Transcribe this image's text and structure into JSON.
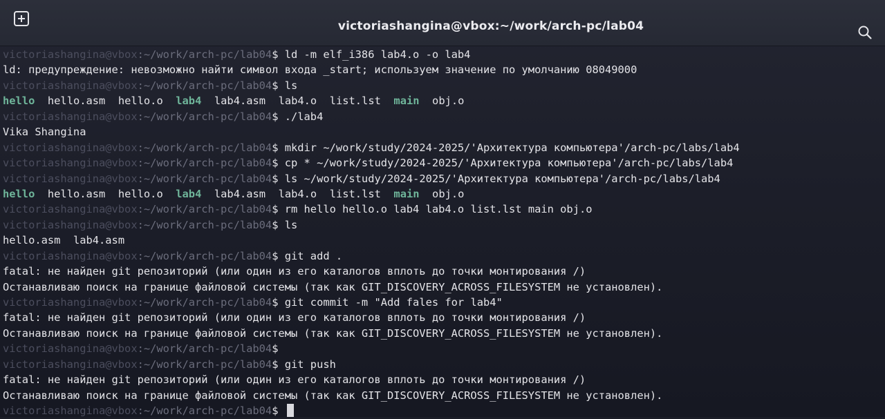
{
  "window": {
    "title": "victoriashangina@vbox:~/work/arch-pc/lab04",
    "new_tab_icon": "new-tab-icon",
    "search_icon": "search-icon"
  },
  "prompt": {
    "user": "victoriashangina@vbox",
    "path": ":~/work/arch-pc/lab04",
    "symbol": "$"
  },
  "colors": {
    "background": "#1b1d27",
    "text": "#e4e4e8",
    "prompt_user": "#4c4e5e",
    "prompt_path": "#6b6d7c",
    "executable": "#6fb59a"
  },
  "terminal": {
    "lines": [
      {
        "type": "prompt",
        "cmd": " ld -m elf_i386 lab4.o -o lab4"
      },
      {
        "type": "output",
        "text": "ld: предупреждение: невозможно найти символ входа _start; используем значение по умолчанию 08049000"
      },
      {
        "type": "prompt",
        "cmd": " ls"
      },
      {
        "type": "ls",
        "items": [
          {
            "name": "hello",
            "exe": true
          },
          {
            "name": "hello.asm",
            "exe": false
          },
          {
            "name": "hello.o",
            "exe": false
          },
          {
            "name": "lab4",
            "exe": true
          },
          {
            "name": "lab4.asm",
            "exe": false
          },
          {
            "name": "lab4.o",
            "exe": false
          },
          {
            "name": "list.lst",
            "exe": false
          },
          {
            "name": "main",
            "exe": true
          },
          {
            "name": "obj.o",
            "exe": false
          }
        ]
      },
      {
        "type": "prompt",
        "cmd": " ./lab4"
      },
      {
        "type": "output",
        "text": "Vika Shangina"
      },
      {
        "type": "prompt",
        "cmd": " mkdir ~/work/study/2024-2025/'Архитектура компьютера'/arch-pc/labs/lab4"
      },
      {
        "type": "prompt",
        "cmd": " cp * ~/work/study/2024-2025/'Архитектура компьютера'/arch-pc/labs/lab4"
      },
      {
        "type": "prompt",
        "cmd": " ls ~/work/study/2024-2025/'Архитектура компьютера'/arch-pc/labs/lab4"
      },
      {
        "type": "ls",
        "items": [
          {
            "name": "hello",
            "exe": true
          },
          {
            "name": "hello.asm",
            "exe": false
          },
          {
            "name": "hello.o",
            "exe": false
          },
          {
            "name": "lab4",
            "exe": true
          },
          {
            "name": "lab4.asm",
            "exe": false
          },
          {
            "name": "lab4.o",
            "exe": false
          },
          {
            "name": "list.lst",
            "exe": false
          },
          {
            "name": "main",
            "exe": true
          },
          {
            "name": "obj.o",
            "exe": false
          }
        ]
      },
      {
        "type": "prompt",
        "cmd": " rm hello hello.o lab4 lab4.o list.lst main obj.o"
      },
      {
        "type": "prompt",
        "cmd": " ls"
      },
      {
        "type": "ls",
        "items": [
          {
            "name": "hello.asm",
            "exe": false
          },
          {
            "name": "lab4.asm",
            "exe": false
          }
        ]
      },
      {
        "type": "prompt",
        "cmd": " git add ."
      },
      {
        "type": "output",
        "text": "fatal: не найден git репозиторий (или один из его каталогов вплоть до точки монтирования /)"
      },
      {
        "type": "output",
        "text": "Останавливаю поиск на границе файловой системы (так как GIT_DISCOVERY_ACROSS_FILESYSTEM не установлен)."
      },
      {
        "type": "prompt",
        "cmd": " git commit -m \"Add fales for lab4\""
      },
      {
        "type": "output",
        "text": "fatal: не найден git репозиторий (или один из его каталогов вплоть до точки монтирования /)"
      },
      {
        "type": "output",
        "text": "Останавливаю поиск на границе файловой системы (так как GIT_DISCOVERY_ACROSS_FILESYSTEM не установлен)."
      },
      {
        "type": "prompt",
        "cmd": ""
      },
      {
        "type": "prompt",
        "cmd": " git push"
      },
      {
        "type": "output",
        "text": "fatal: не найден git репозиторий (или один из его каталогов вплоть до точки монтирования /)"
      },
      {
        "type": "output",
        "text": "Останавливаю поиск на границе файловой системы (так как GIT_DISCOVERY_ACROSS_FILESYSTEM не установлен)."
      },
      {
        "type": "prompt",
        "cmd": " ",
        "cursor": true
      }
    ]
  }
}
